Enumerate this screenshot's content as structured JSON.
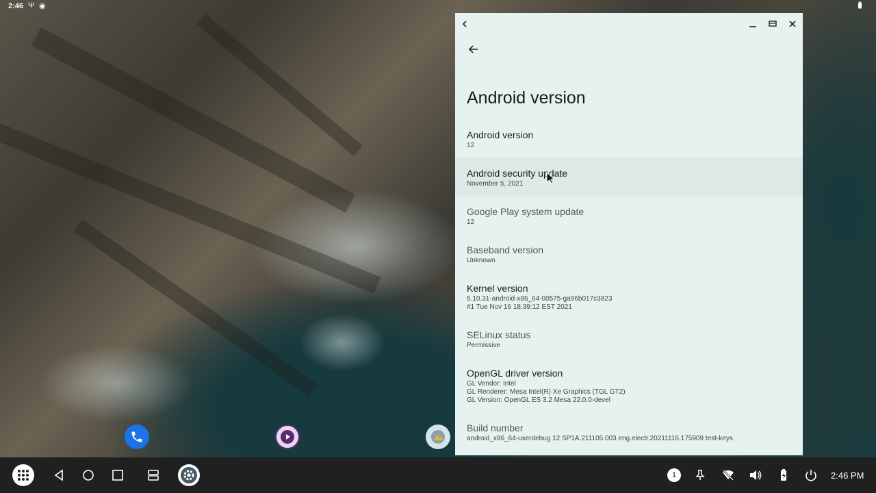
{
  "status_bar": {
    "time": "2:46",
    "icons": [
      "usb-icon",
      "location-icon",
      "battery-icon"
    ]
  },
  "window": {
    "titlebar": {
      "icons": [
        "chevron-left-icon",
        "minimize-icon",
        "maximize-icon",
        "close-icon"
      ]
    },
    "page_title": "Android version",
    "rows": [
      {
        "title": "Android version",
        "lines": [
          "12"
        ]
      },
      {
        "title": "Android security update",
        "lines": [
          "November 5, 2021"
        ]
      },
      {
        "title": "Google Play system update",
        "lines": [
          "12"
        ]
      },
      {
        "title": "Baseband version",
        "lines": [
          "Unknown"
        ]
      },
      {
        "title": "Kernel version",
        "lines": [
          "5.10.31-android-x86_64-00575-ga96b017c3823",
          "#1 Tue Nov 16 18:39:12 EST 2021"
        ]
      },
      {
        "title": "SELinux status",
        "lines": [
          "Permissive"
        ]
      },
      {
        "title": "OpenGL driver version",
        "lines": [
          "GL Vendor: Intel",
          "GL Renderer: Mesa Intel(R) Xe Graphics (TGL GT2)",
          "GL Version: OpenGL ES 3.2 Mesa 22.0.0-devel"
        ]
      },
      {
        "title": "Build number",
        "lines": [
          "android_x86_64-userdebug 12 SP1A.211105.003 eng.electr.20211116.175909 test-keys"
        ]
      }
    ]
  },
  "dock": {
    "icons": [
      "phone-icon",
      "video-player-icon",
      "photos-app-icon"
    ]
  },
  "taskbar": {
    "notification_count": "1",
    "clock": "2:46 PM",
    "icons": [
      "app-drawer-icon",
      "back-icon",
      "home-icon",
      "recents-icon",
      "split-screen-icon",
      "settings-icon",
      "pin-icon",
      "wifi-off-icon",
      "volume-icon",
      "battery-icon",
      "power-icon"
    ]
  },
  "colors": {
    "window_bg": "#e6f2f0",
    "highlight_row": "#dde9e7",
    "taskbar_bg": "#1f2020",
    "phone_blue": "#1a73e8",
    "video_purple": "#5a2a6e"
  }
}
